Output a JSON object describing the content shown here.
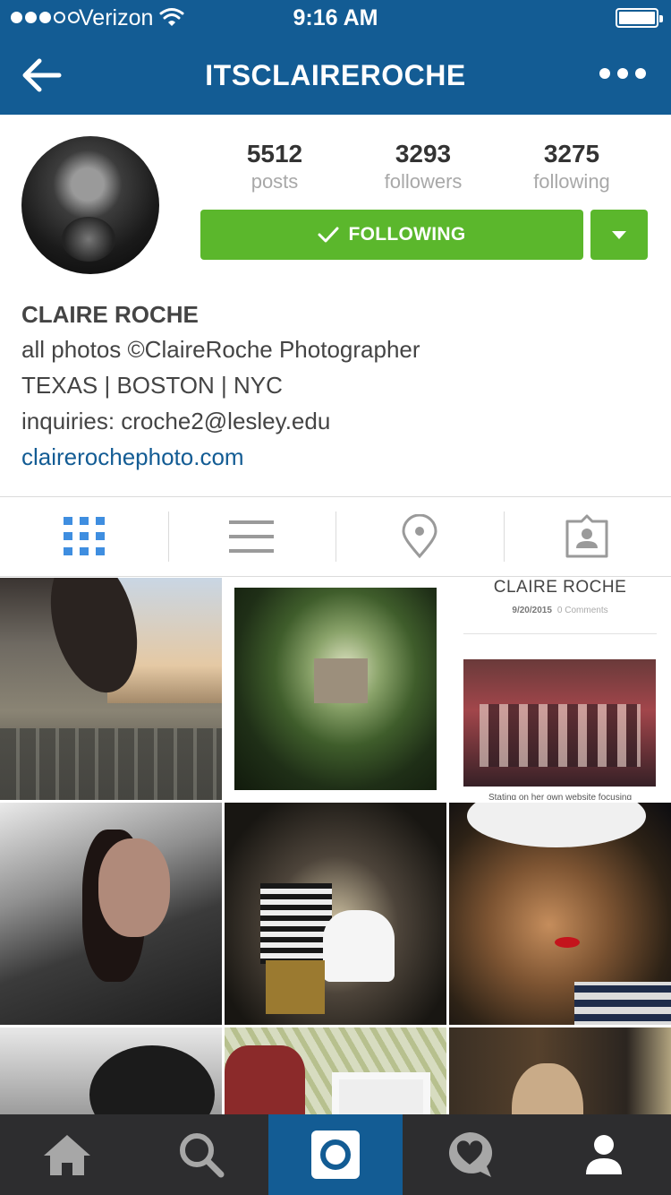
{
  "status_bar": {
    "carrier": "Verizon",
    "time": "9:16 AM",
    "signal_bars": 3,
    "signal_total": 5
  },
  "nav": {
    "title": "ITSCLAIREROCHE",
    "back_icon": "arrow-left-icon",
    "more_icon": "more-dots-icon"
  },
  "profile": {
    "stats": [
      {
        "value": "5512",
        "label": "posts"
      },
      {
        "value": "3293",
        "label": "followers"
      },
      {
        "value": "3275",
        "label": "following"
      }
    ],
    "follow_button_label": "FOLLOWING",
    "name": "CLAIRE ROCHE",
    "bio_lines": [
      "all photos ©ClaireRoche Photographer",
      "TEXAS | BOSTON | NYC",
      "inquiries: croche2@lesley.edu"
    ],
    "website": "clairerochephoto.com"
  },
  "tabs": [
    {
      "name": "grid-view",
      "icon": "grid-icon",
      "active": true
    },
    {
      "name": "list-view",
      "icon": "list-icon",
      "active": false
    },
    {
      "name": "places",
      "icon": "location-pin-icon",
      "active": false
    },
    {
      "name": "tagged-photos",
      "icon": "tagged-person-icon",
      "active": false
    }
  ],
  "grid_tiles": {
    "tile_3_header": "CLAIRE ROCHE",
    "tile_3_date": "9/20/2015",
    "tile_3_comments": "0 Comments",
    "tile_3_snippet": "Stating on her own website focusing"
  },
  "bottom_bar": [
    {
      "name": "home",
      "icon": "home-icon",
      "active": false
    },
    {
      "name": "search",
      "icon": "search-icon",
      "active": false
    },
    {
      "name": "camera",
      "icon": "camera-icon",
      "active": true
    },
    {
      "name": "activity",
      "icon": "heart-bubble-icon",
      "active": false
    },
    {
      "name": "profile",
      "icon": "profile-icon",
      "active": false
    }
  ],
  "colors": {
    "brand": "#135c94",
    "follow_green": "#5bb72c",
    "bottom_bar": "#2d2d2f",
    "active_tab_icon": "#3f8ee0",
    "inactive_tab_icon": "#9a9a9a"
  }
}
